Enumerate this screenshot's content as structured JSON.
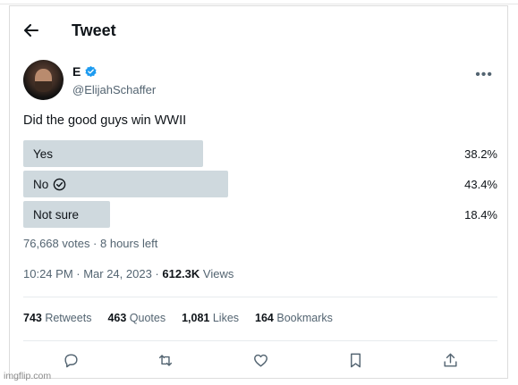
{
  "header": {
    "title": "Tweet"
  },
  "author": {
    "name": "E",
    "handle": "@ElijahSchaffer"
  },
  "tweet": {
    "text": "Did the good guys win WWII"
  },
  "poll": {
    "options": [
      {
        "label": "Yes",
        "percent_text": "38.2%",
        "percent": 38.2,
        "winner": false
      },
      {
        "label": "No",
        "percent_text": "43.4%",
        "percent": 43.4,
        "winner": true
      },
      {
        "label": "Not sure",
        "percent_text": "18.4%",
        "percent": 18.4,
        "winner": false
      }
    ],
    "meta": "76,668 votes · 8 hours left"
  },
  "timestamp": {
    "text": "10:24 PM · Mar 24, 2023 · ",
    "views_count": "612.3K",
    "views_label": " Views"
  },
  "stats": {
    "retweets_count": "743",
    "retweets_label": " Retweets",
    "quotes_count": "463",
    "quotes_label": " Quotes",
    "likes_count": "1,081",
    "likes_label": " Likes",
    "bookmarks_count": "164",
    "bookmarks_label": " Bookmarks"
  },
  "icons": {
    "back": "arrow-left-icon",
    "verified": "verified-badge-icon",
    "more": "more-horizontal-icon",
    "winner_check": "check-circle-icon",
    "reply": "reply-icon",
    "retweet": "retweet-icon",
    "like": "heart-icon",
    "bookmark": "bookmark-icon",
    "share": "share-icon"
  },
  "colors": {
    "verified_blue": "#1d9bf0",
    "poll_bar": "#cfd9de",
    "secondary_text": "#536471",
    "primary_text": "#0f1419"
  },
  "watermark": "imgflip.com"
}
